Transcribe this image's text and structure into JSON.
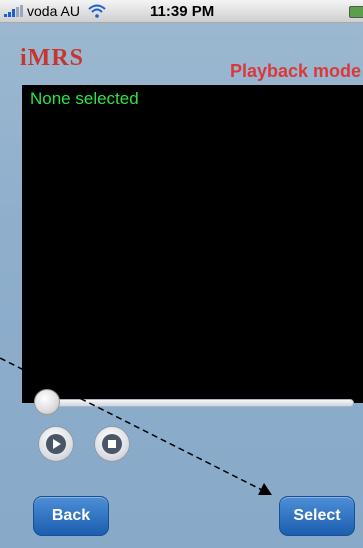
{
  "status_bar": {
    "carrier": "voda AU",
    "time": "11:39 PM"
  },
  "app": {
    "logo": "iMRS",
    "mode_label": "Playback mode",
    "selection_status": "None selected",
    "playback_progress": 0
  },
  "buttons": {
    "back": "Back",
    "select": "Select"
  },
  "colors": {
    "accent_red": "#d9393b",
    "status_green": "#2fe24a",
    "button_blue": "#1b5eb0"
  }
}
